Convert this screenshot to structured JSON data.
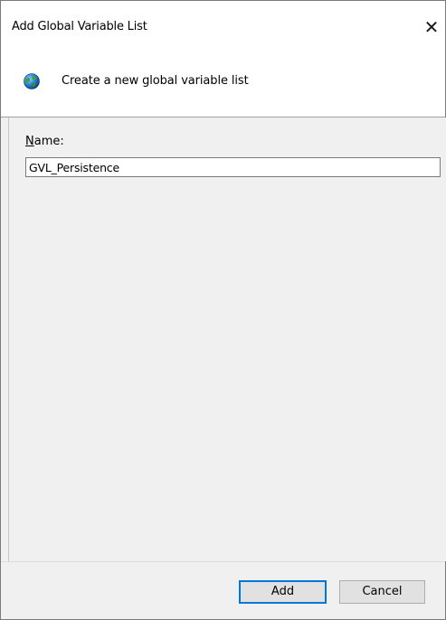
{
  "dialog": {
    "title": "Add Global Variable List",
    "close_symbol": "✕",
    "close_icon": "close-icon"
  },
  "header": {
    "icon": "globe-icon",
    "text": "Create a new global variable list"
  },
  "form": {
    "name_label_accel": "N",
    "name_label_rest": "ame:",
    "name_value": "GVL_Persistence"
  },
  "footer": {
    "add_label": "Add",
    "cancel_label": "Cancel"
  },
  "colors": {
    "accent": "#0078d7",
    "body_bg": "#f0f0f0",
    "button_bg": "#e1e1e1"
  }
}
